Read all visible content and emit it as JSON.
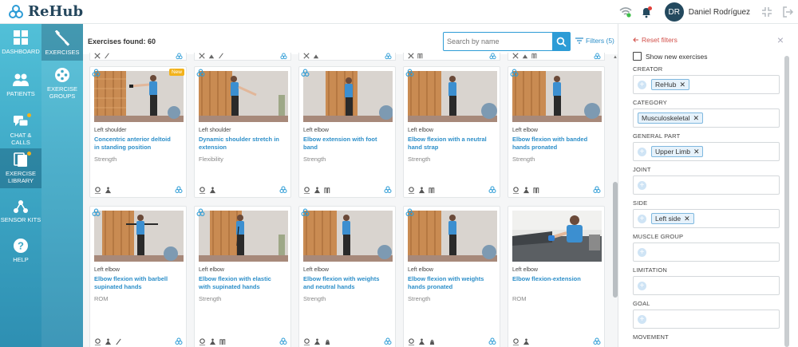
{
  "app": {
    "name": "ReHub"
  },
  "user": {
    "initials": "DR",
    "name": "Daniel Rodríguez"
  },
  "colors": {
    "accent": "#2d9cd6",
    "sidebar_top": "#52c0d8",
    "sidebar_bottom": "#2e8fb2",
    "new_badge": "#f2b21b",
    "reset": "#d2504a"
  },
  "nav": {
    "items": [
      {
        "label_1": "DASHBOARD",
        "label_2": "",
        "icon": "dashboard-icon"
      },
      {
        "label_1": "PATIENTS",
        "label_2": "",
        "icon": "patients-icon"
      },
      {
        "label_1": "CHAT & CALLS",
        "label_2": "",
        "icon": "chat-icon"
      },
      {
        "label_1": "EXERCISE",
        "label_2": "LIBRARY",
        "icon": "library-icon"
      },
      {
        "label_1": "SENSOR KITS",
        "label_2": "",
        "icon": "sensor-icon"
      },
      {
        "label_1": "HELP",
        "label_2": "",
        "icon": "help-icon"
      }
    ],
    "sub": [
      {
        "label_1": "EXERCISES",
        "label_2": "",
        "icon": "exercises-icon"
      },
      {
        "label_1": "EXERCISE",
        "label_2": "GROUPS",
        "icon": "groups-icon"
      }
    ]
  },
  "toolbar": {
    "found": "Exercises found: 60",
    "search_placeholder": "Search by name",
    "filters_label": "Filters (5)"
  },
  "cards": [
    {
      "part": "Left shoulder",
      "title_1": "Concentric anterior deltoid",
      "title_2": "in standing position",
      "category": "Strength",
      "is_new": true,
      "badge": "New"
    },
    {
      "part": "Left shoulder",
      "title_1": "Dynamic shoulder stretch in",
      "title_2": "extension",
      "category": "Flexibility",
      "is_new": false,
      "badge": ""
    },
    {
      "part": "Left elbow",
      "title_1": "Elbow extension with foot",
      "title_2": "band",
      "category": "Strength",
      "is_new": false,
      "badge": ""
    },
    {
      "part": "Left elbow",
      "title_1": "Elbow flexion with a neutral",
      "title_2": "hand strap",
      "category": "Strength",
      "is_new": false,
      "badge": ""
    },
    {
      "part": "Left elbow",
      "title_1": "Elbow flexion with banded",
      "title_2": "hands pronated",
      "category": "Strength",
      "is_new": false,
      "badge": ""
    },
    {
      "part": "Left elbow",
      "title_1": "Elbow flexion with barbell",
      "title_2": "supinated hands",
      "category": "ROM",
      "is_new": false,
      "badge": ""
    },
    {
      "part": "Left elbow",
      "title_1": "Elbow flexion with elastic",
      "title_2": "with supinated hands",
      "category": "Strength",
      "is_new": false,
      "badge": ""
    },
    {
      "part": "Left elbow",
      "title_1": "Elbow flexion with weights",
      "title_2": "and neutral hands",
      "category": "Strength",
      "is_new": false,
      "badge": ""
    },
    {
      "part": "Left elbow",
      "title_1": "Elbow flexion with weights",
      "title_2": "hands pronated",
      "category": "Strength",
      "is_new": false,
      "badge": ""
    },
    {
      "part": "Left elbow",
      "title_1": "Elbow flexion-extension",
      "title_2": "",
      "category": "ROM",
      "is_new": false,
      "badge": ""
    }
  ],
  "filters": {
    "reset_label": "Reset filters",
    "show_new_label": "Show new exercises",
    "groups": [
      {
        "label": "CREATOR",
        "chips": [
          "ReHub"
        ]
      },
      {
        "label": "CATEGORY",
        "chips": [
          "Musculoskeletal"
        ]
      },
      {
        "label": "GENERAL PART",
        "chips": [
          "Upper Limb"
        ]
      },
      {
        "label": "JOINT",
        "chips": []
      },
      {
        "label": "SIDE",
        "chips": [
          "Left side"
        ]
      },
      {
        "label": "MUSCLE GROUP",
        "chips": []
      },
      {
        "label": "LIMITATION",
        "chips": []
      },
      {
        "label": "GOAL",
        "chips": []
      },
      {
        "label": "MOVEMENT",
        "chips": []
      }
    ]
  }
}
